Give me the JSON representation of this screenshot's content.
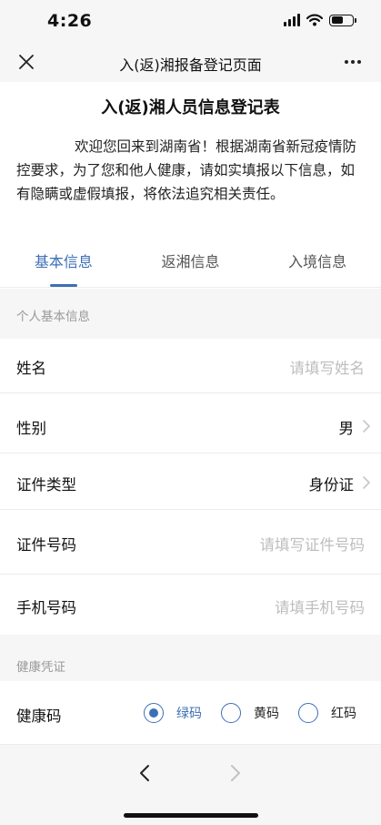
{
  "status_bar": {
    "time": "4:26",
    "battery_level": 0.55
  },
  "nav": {
    "title": "入(返)湘报备登记页面"
  },
  "form": {
    "title": "入(返)湘人员信息登记表",
    "intro": "欢迎您回来到湖南省！根据湖南省新冠疫情防控要求，为了您和他人健康，请如实填报以下信息，如有隐瞒或虚假填报，将依法追究相关责任。"
  },
  "tabs": [
    {
      "label": "基本信息",
      "active": true
    },
    {
      "label": "返湘信息",
      "active": false
    },
    {
      "label": "入境信息",
      "active": false
    }
  ],
  "sections": {
    "personal": "个人基本信息",
    "health": "健康凭证"
  },
  "fields": {
    "name": {
      "label": "姓名",
      "placeholder": "请填写姓名"
    },
    "gender": {
      "label": "性别",
      "value": "男"
    },
    "id_type": {
      "label": "证件类型",
      "value": "身份证"
    },
    "id_number": {
      "label": "证件号码",
      "placeholder": "请填写证件号码"
    },
    "phone": {
      "label": "手机号码",
      "placeholder": "请填手机号码"
    },
    "health_code": {
      "label": "健康码",
      "options": [
        "绿码",
        "黄码",
        "红码"
      ],
      "selected": "绿码"
    }
  },
  "colors": {
    "accent": "#3d6fb6",
    "bar_background": "#f6f6f6",
    "placeholder": "#bdbdbd"
  }
}
